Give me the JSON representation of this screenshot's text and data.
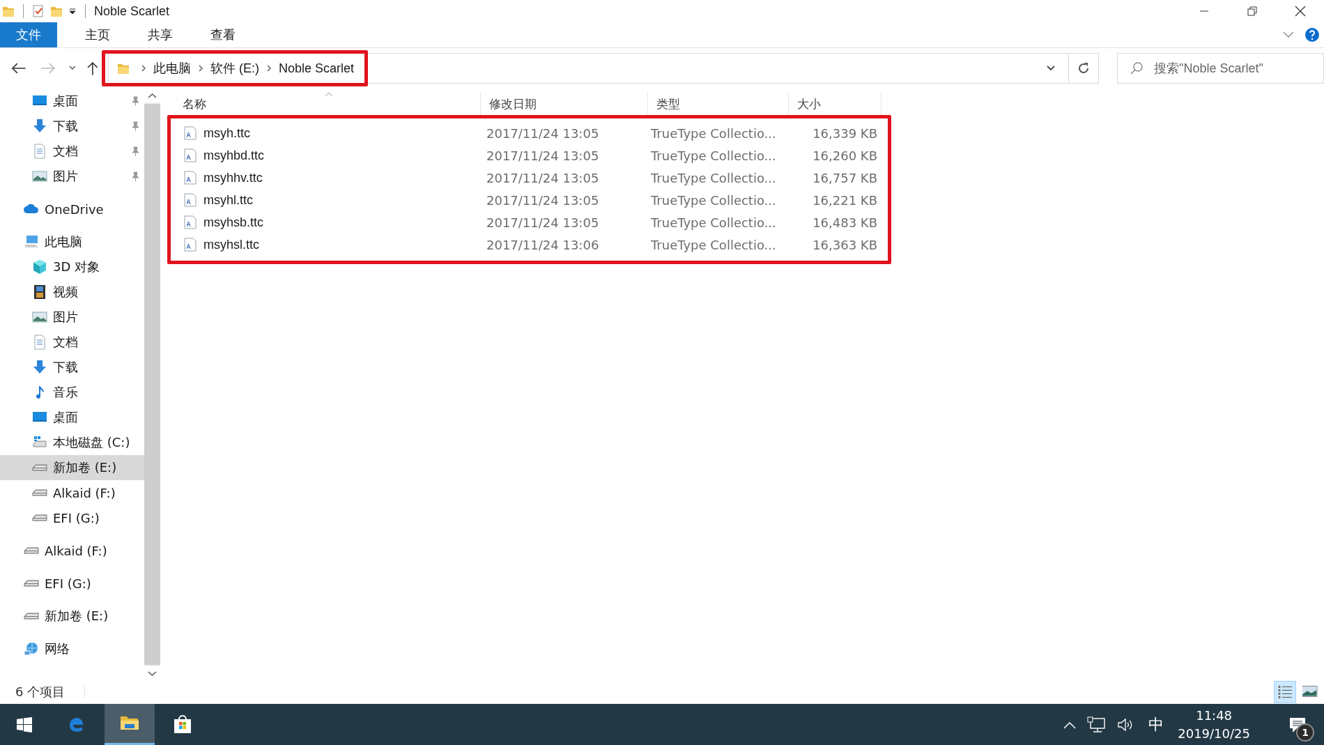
{
  "window": {
    "title": "Noble Scarlet"
  },
  "ribbon_tabs": [
    {
      "label": "文件",
      "kind": "file-menu",
      "selected": false
    },
    {
      "label": "主页",
      "kind": "tab",
      "selected": false
    },
    {
      "label": "共享",
      "kind": "tab",
      "selected": false
    },
    {
      "label": "查看",
      "kind": "tab",
      "selected": false
    }
  ],
  "address_bar": {
    "path": [
      "此电脑",
      "软件 (E:)",
      "Noble Scarlet"
    ],
    "highlighted": true
  },
  "search": {
    "placeholder": "搜索\"Noble Scarlet\""
  },
  "sidebar": {
    "pinned_items": [
      {
        "label": "桌面",
        "kind": "desktop",
        "selected": false
      },
      {
        "label": "下载",
        "kind": "download",
        "selected": false
      },
      {
        "label": "文档",
        "kind": "document",
        "selected": false
      },
      {
        "label": "图片",
        "kind": "picture",
        "selected": false
      }
    ],
    "items": [
      {
        "label": "OneDrive",
        "kind": "cloud",
        "selected": false
      },
      {
        "label": "此电脑",
        "kind": "computer",
        "selected": false,
        "children": [
          {
            "label": "3D 对象",
            "kind": "cube",
            "selected": false
          },
          {
            "label": "视频",
            "kind": "video",
            "selected": false
          },
          {
            "label": "图片",
            "kind": "picture",
            "selected": false
          },
          {
            "label": "文档",
            "kind": "document",
            "selected": false
          },
          {
            "label": "下载",
            "kind": "download",
            "selected": false
          },
          {
            "label": "音乐",
            "kind": "music",
            "selected": false
          },
          {
            "label": "桌面",
            "kind": "desktop",
            "selected": false
          },
          {
            "label": "本地磁盘 (C:)",
            "kind": "system-drive",
            "selected": false
          },
          {
            "label": "新加卷 (E:)",
            "kind": "drive",
            "selected": true
          },
          {
            "label": "Alkaid (F:)",
            "kind": "drive",
            "selected": false
          },
          {
            "label": "EFI (G:)",
            "kind": "drive",
            "selected": false
          }
        ]
      },
      {
        "label": "Alkaid (F:)",
        "kind": "drive",
        "selected": false
      },
      {
        "label": "EFI (G:)",
        "kind": "drive",
        "selected": false
      },
      {
        "label": "新加卷 (E:)",
        "kind": "drive",
        "selected": false
      },
      {
        "label": "网络",
        "kind": "network",
        "selected": false
      }
    ]
  },
  "file_list": {
    "highlighted": true,
    "columns": [
      {
        "label": "名称",
        "sorted": true
      },
      {
        "label": "修改日期",
        "sorted": false
      },
      {
        "label": "类型",
        "sorted": false
      },
      {
        "label": "大小",
        "sorted": false
      }
    ],
    "rows": [
      {
        "name": "msyh.ttc",
        "modified": "2017/11/24 13:05",
        "type": "TrueType Collectio...",
        "size": "16,339 KB"
      },
      {
        "name": "msyhbd.ttc",
        "modified": "2017/11/24 13:05",
        "type": "TrueType Collectio...",
        "size": "16,260 KB"
      },
      {
        "name": "msyhhv.ttc",
        "modified": "2017/11/24 13:05",
        "type": "TrueType Collectio...",
        "size": "16,757 KB"
      },
      {
        "name": "msyhl.ttc",
        "modified": "2017/11/24 13:05",
        "type": "TrueType Collectio...",
        "size": "16,221 KB"
      },
      {
        "name": "msyhsb.ttc",
        "modified": "2017/11/24 13:05",
        "type": "TrueType Collectio...",
        "size": "16,483 KB"
      },
      {
        "name": "msyhsl.ttc",
        "modified": "2017/11/24 13:06",
        "type": "TrueType Collectio...",
        "size": "16,363 KB"
      }
    ]
  },
  "status_bar": {
    "item_count": "6 个项目",
    "view_modes": [
      {
        "kind": "details",
        "selected": true
      },
      {
        "kind": "large-icons",
        "selected": false
      }
    ]
  },
  "taskbar": {
    "apps": [
      {
        "kind": "edge",
        "active": false
      },
      {
        "kind": "explorer",
        "active": true
      },
      {
        "kind": "store",
        "active": false
      }
    ],
    "ime": "中",
    "time": "11:48",
    "date": "2019/10/25",
    "notification_count": "1"
  }
}
